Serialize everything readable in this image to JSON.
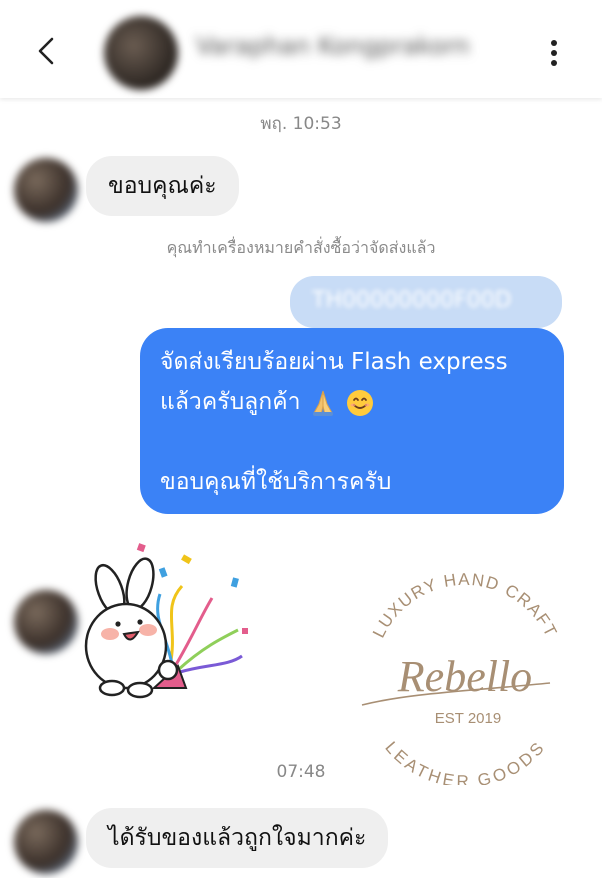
{
  "header": {
    "contact_name": "Varaphan Kongprakorn"
  },
  "messages": {
    "timestamp_1": "พฤ. 10:53",
    "incoming_1": "ขอบคุณค่ะ",
    "system_note": "คุณทำเครื่องหมายคำสั่งซื้อว่าจัดส่งแล้ว",
    "reply_preview": "TH00000000F00D",
    "outgoing_line_1": "จัดส่งเรียบร้อยผ่าน Flash express",
    "outgoing_line_2": "แล้วครับลูกค้า",
    "outgoing_line_3": "ขอบคุณที่ใช้บริการครับ",
    "timestamp_2": "07:48",
    "incoming_2": "ได้รับของแล้วถูกใจมากค่ะ"
  },
  "logo": {
    "top_arc": "LUXURY HAND CRAFT",
    "script": "Rebello",
    "est": "EST 2019",
    "bottom_arc": "LEATHER GOODS"
  },
  "colors": {
    "outgoing_bubble": "#3b82f6",
    "incoming_bubble": "#efefef",
    "logo_brown": "#a88f74"
  }
}
